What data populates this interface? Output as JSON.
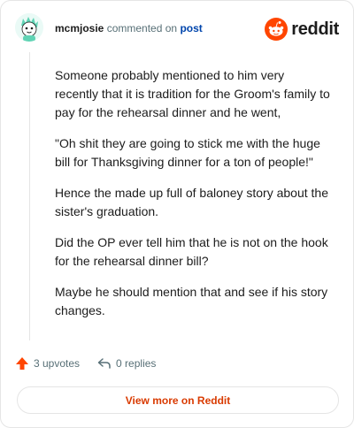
{
  "comment": {
    "author": "mcmjosie",
    "action_text": "commented on",
    "post_link_text": "post",
    "paragraphs": [
      "Someone probably mentioned to him very recently that it is tradition for the Groom's family to pay for the rehearsal dinner and he went,",
      "\"Oh shit they are going to stick me with the huge bill for Thanksgiving dinner for a ton of people!\"",
      "Hence the made up full of baloney story about the sister's graduation.",
      "Did the OP ever tell him that he is not on the hook for the rehearsal dinner bill?",
      "Maybe he should mention that and see if his story changes."
    ],
    "upvotes_label": "3 upvotes",
    "replies_label": "0 replies"
  },
  "brand": {
    "name": "reddit",
    "logo_icon": "reddit-snoo-icon"
  },
  "footer": {
    "view_button_label": "View more on Reddit"
  },
  "colors": {
    "brand_orange": "#ff4500",
    "link_blue": "#0045ac",
    "view_button_text": "#d93a00",
    "muted": "#576f76"
  }
}
